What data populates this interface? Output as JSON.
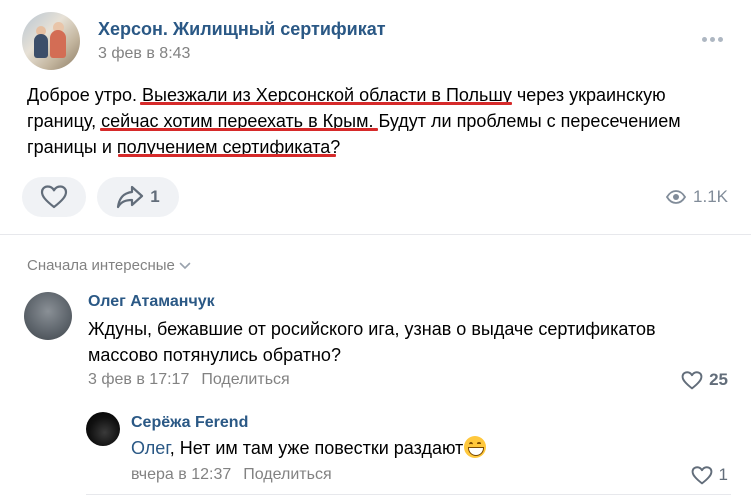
{
  "post": {
    "group_name": "Херсон. Жилищный сертификат",
    "date": "3 фев в 8:43",
    "text_line1": "Доброе утро. Выезжали из Херсонской области в Польшу через украинскую",
    "text_line2": "границу, сейчас хотим переехать в Крым. Будут ли проблемы с пересечением",
    "text_line3": "границы и получением сертификата?",
    "share_count": "1",
    "views": "1.1K"
  },
  "comments_sort": "Сначала интересные",
  "comments": [
    {
      "author": "Олег Атаманчук",
      "text_line1": "Ждуны, бежавшие от росийского ига, узнав о выдаче сертификатов",
      "text_line2": "массово потянулись обратно?",
      "date": "3 фев в 17:17",
      "share_label": "Поделиться",
      "likes": "25"
    },
    {
      "author": "Серёжа Ferend",
      "mention": "Олег",
      "text": ", Нет им там уже повестки раздают",
      "date": "вчера в 12:37",
      "share_label": "Поделиться",
      "likes": "1"
    }
  ],
  "colors": {
    "link": "#2a5885",
    "secondary_text": "#828282",
    "underline": "#d62a2a",
    "button_bg": "#f0f2f5"
  },
  "icons": [
    "more-icon",
    "heart-icon",
    "share-icon",
    "eye-icon",
    "chevron-down-icon",
    "grin-emoji-icon"
  ]
}
